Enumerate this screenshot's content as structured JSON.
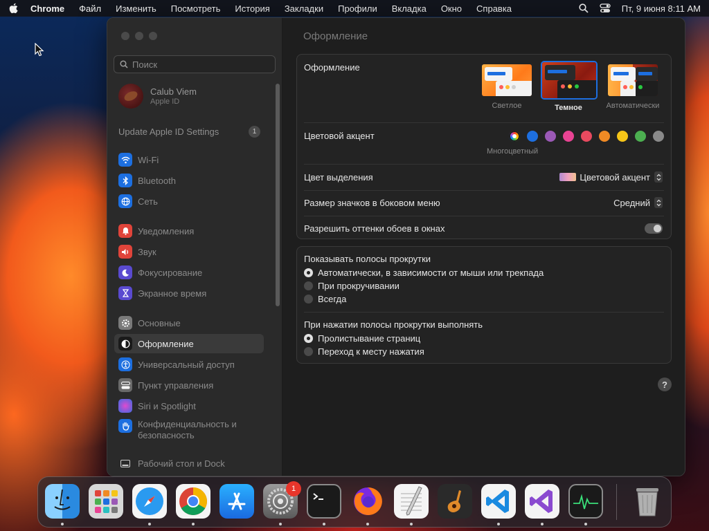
{
  "menubar": {
    "app": "Chrome",
    "items": [
      "Файл",
      "Изменить",
      "Посмотреть",
      "История",
      "Закладки",
      "Профили",
      "Вкладка",
      "Окно",
      "Справка"
    ],
    "clock": "Пт, 9 июня  8:11 AM"
  },
  "sidebar": {
    "search_placeholder": "Поиск",
    "profile": {
      "name": "Calub Viem",
      "sub": "Apple ID"
    },
    "update": {
      "label": "Update Apple ID Settings",
      "badge": "1"
    },
    "items": [
      {
        "label": "Wi-Fi",
        "icon": "wifi-icon",
        "color": "#1d6fe0"
      },
      {
        "label": "Bluetooth",
        "icon": "bluetooth-icon",
        "color": "#1d6fe0"
      },
      {
        "label": "Сеть",
        "icon": "globe-icon",
        "color": "#1d6fe0"
      },
      {
        "label": "Уведомления",
        "icon": "bell-icon",
        "color": "#e0443a"
      },
      {
        "label": "Звук",
        "icon": "speaker-icon",
        "color": "#e0443a"
      },
      {
        "label": "Фокусирование",
        "icon": "moon-icon",
        "color": "#5a4ad0"
      },
      {
        "label": "Экранное время",
        "icon": "hourglass-icon",
        "color": "#5a4ad0"
      },
      {
        "label": "Основные",
        "icon": "gear-icon",
        "color": "#7a7a7a"
      },
      {
        "label": "Оформление",
        "icon": "appearance-icon",
        "color": "#1a1a1a"
      },
      {
        "label": "Универсальный доступ",
        "icon": "accessibility-icon",
        "color": "#1d6fe0"
      },
      {
        "label": "Пункт управления",
        "icon": "control-center-icon",
        "color": "#6a6a6a"
      },
      {
        "label": "Siri и Spotlight",
        "icon": "siri-icon",
        "color": "#9a4ad0"
      },
      {
        "label": "Конфиденциальность и безопасность",
        "icon": "hand-icon",
        "color": "#1d6fe0"
      },
      {
        "label": "Рабочий стол и Dock",
        "icon": "dock-icon",
        "color": "#2a2a2a"
      }
    ]
  },
  "content": {
    "title": "Оформление",
    "appearance": {
      "label": "Оформление",
      "options": [
        "Светлое",
        "Темное",
        "Автоматически"
      ],
      "selected": "Темное"
    },
    "accent": {
      "label": "Цветовой акцент",
      "colors": [
        "#1d6fe0",
        "#9b59b6",
        "#e84393",
        "#e84a5f",
        "#f08a24",
        "#f5c518",
        "#4caf50",
        "#8a8a8a"
      ],
      "caption": "Многоцветный"
    },
    "highlight": {
      "label": "Цвет выделения",
      "value": "Цветовой акцент"
    },
    "sidebar_icon_size": {
      "label": "Размер значков в боковом меню",
      "value": "Средний"
    },
    "wallpaper_tint": {
      "label": "Разрешить оттенки обоев в окнах"
    },
    "scrollbars": {
      "label": "Показывать полосы прокрутки",
      "options": [
        "Автоматически, в зависимости от мыши или трекпада",
        "При прокручивании",
        "Всегда"
      ]
    },
    "click": {
      "label": "При нажатии полосы прокрутки выполнять",
      "options": [
        "Пролистывание страниц",
        "Переход к месту нажатия"
      ]
    },
    "help": "?"
  },
  "dock": {
    "badge": "1",
    "apps": [
      "finder-icon",
      "launchpad-icon",
      "safari-icon",
      "chrome-icon",
      "app-store-icon",
      "system-settings-icon",
      "terminal-icon",
      "firefox-icon",
      "textedit-icon",
      "garageband-icon",
      "vscode-icon",
      "visual-studio-icon",
      "activity-monitor-icon",
      "trash-icon"
    ]
  }
}
